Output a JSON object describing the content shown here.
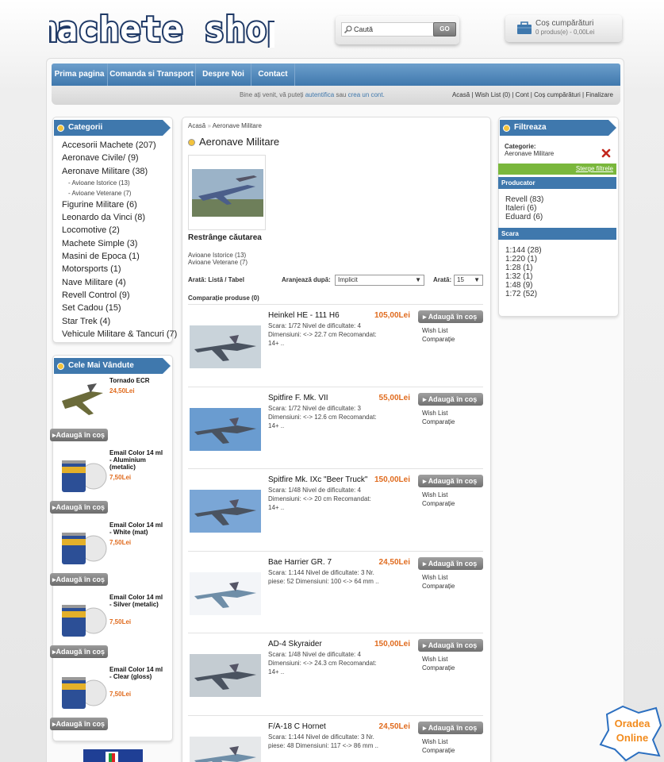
{
  "header": {
    "logo_text": "machete shop",
    "search_placeholder": "Caută",
    "search_button": "GO",
    "cart_title": "Coș cumpărături",
    "cart_summary": "0 produs(e) - 0,00Lei"
  },
  "nav": [
    "Prima pagina",
    "Comanda si Transport",
    "Despre Noi",
    "Contact"
  ],
  "subbar": {
    "welcome_pre": "Bine ați venit, vă puteți",
    "login_link": "autentifica",
    "mid": "sau",
    "register_link": "crea un cont.",
    "links": "Acasă | Wish List (0) | Cont | Coș cumpărături | Finalizare"
  },
  "sidebar": {
    "categories_title": "Categorii",
    "categories": [
      {
        "label": "Accesorii Machete (207)"
      },
      {
        "label": "Aeronave Civile/ (9)"
      },
      {
        "label": "Aeronave Militare (38)"
      },
      {
        "label": "- Avioane Istorice (13)",
        "sub": true
      },
      {
        "label": "- Avioane Veterane (7)",
        "sub": true
      },
      {
        "label": "Figurine Militare (6)"
      },
      {
        "label": "Leonardo da Vinci (8)"
      },
      {
        "label": "Locomotive (2)"
      },
      {
        "label": "Machete Simple (3)"
      },
      {
        "label": "Masini de Epoca (1)"
      },
      {
        "label": "Motorsports (1)"
      },
      {
        "label": "Nave Militare (4)"
      },
      {
        "label": "Revell Control (9)"
      },
      {
        "label": "Set Cadou (15)"
      },
      {
        "label": "Star Trek (4)"
      },
      {
        "label": "Vehicule Militare & Tancuri (7)"
      }
    ],
    "bestsellers_title": "Cele Mai Vândute",
    "add_label": "Adaugă în coș",
    "bestsellers": [
      {
        "name": "Tornado ECR",
        "price": "24,50Lei"
      },
      {
        "name": "Email Color 14 ml - Aluminium (metalic)",
        "price": "7,50Lei"
      },
      {
        "name": "Email Color 14 ml - White (mat)",
        "price": "7,50Lei"
      },
      {
        "name": "Email Color 14 ml - Silver (metalic)",
        "price": "7,50Lei"
      },
      {
        "name": "Email Color 14 ml - Clear (gloss)",
        "price": "7,50Lei"
      }
    ]
  },
  "content": {
    "breadcrumb_home": "Acasă",
    "breadcrumb_sep": "»",
    "breadcrumb_current": "Aeronave Militare",
    "title": "Aeronave Militare",
    "refine_title": "Restrânge căutarea",
    "refine_links": [
      "Avioane Istorice (13)",
      "Avioane Veterane (7)"
    ],
    "display_label": "Arată: Listă / Tabel",
    "sort_label": "Aranjează după:",
    "sort_value": "Implicit",
    "show_label": "Arată:",
    "show_value": "15",
    "compare_label": "Comparație produse (0)",
    "add_label": "Adaugă în coș",
    "wishlist_label": "Wish List",
    "compare_link": "Comparație",
    "products": [
      {
        "name": "Heinkel HE - 111 H6",
        "price": "105,00Lei",
        "desc": "Scara: 1/72 Nivel de dificultate: 4 Dimensiuni: <-> 22.7 cm Recomandat: 14+ .."
      },
      {
        "name": "Spitfire F. Mk. VII",
        "price": "55,00Lei",
        "desc": "Scara: 1/72 Nivel de dificultate: 3 Dimensiuni: <-> 12.6 cm Recomandat: 14+ .."
      },
      {
        "name": "Spitfire Mk. IXc \"Beer Truck\"",
        "price": "150,00Lei",
        "desc": "Scara: 1/48 Nivel de dificultate: 4 Dimensiuni: <-> 20 cm Recomandat: 14+ .."
      },
      {
        "name": "Bae Harrier GR. 7",
        "price": "24,50Lei",
        "desc": "Scara: 1:144 Nivel de dificultate: 3 Nr. piese: 52 Dimensiuni: 100 <-> 64 mm .."
      },
      {
        "name": "AD-4 Skyraider",
        "price": "150,00Lei",
        "desc": "Scara: 1/48 Nivel de dificultate: 4 Dimensiuni: <-> 24.3 cm Recomandat: 14+ .."
      },
      {
        "name": "F/A-18 C Hornet",
        "price": "24,50Lei",
        "desc": "Scara: 1:144 Nivel de dificultate: 3 Nr. piese: 48 Dimensiuni: 117 <-> 86 mm .."
      }
    ]
  },
  "filter": {
    "title": "Filtreaza",
    "category_label": "Categorie:",
    "category_value": "Aeronave Militare",
    "clear": "Sterge filtrele",
    "producer_title": "Producator",
    "producers": [
      "Revell (83)",
      "Italeri (6)",
      "Eduard (6)"
    ],
    "scale_title": "Scara",
    "scales": [
      "1:144 (28)",
      "1:220 (1)",
      "1:28 (1)",
      "1:32 (1)",
      "1:48 (9)",
      "1:72 (52)"
    ]
  },
  "badge": {
    "line1": "Oradea",
    "line2": "Online"
  },
  "colors": {
    "nav_blue": "#3f78ad",
    "price_orange": "#e06b1e",
    "filter_green": "#7ab73c"
  }
}
